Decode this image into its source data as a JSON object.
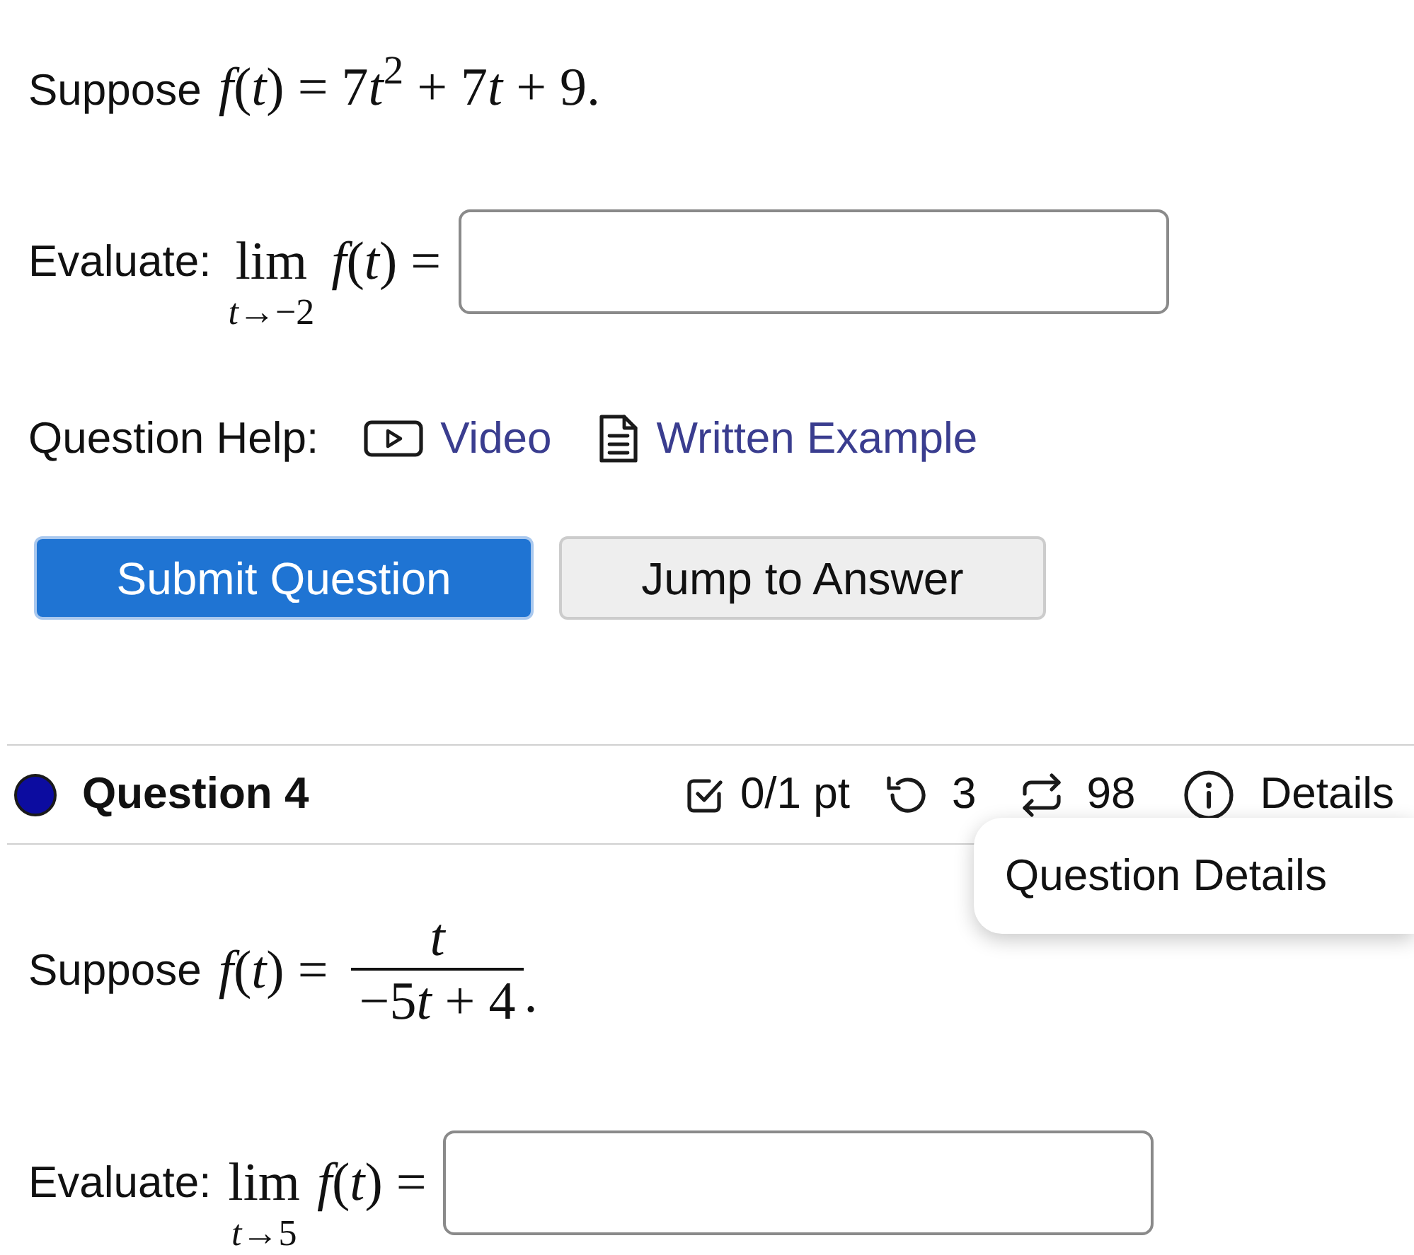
{
  "question_3": {
    "statement": {
      "label": "Suppose",
      "formula": "f(t) = 7t$^{2}$ + 7t + 9."
    },
    "evaluate": {
      "label": "Evaluate:",
      "operator": "lim",
      "subscript": "t→−2",
      "expression": "f(t) ="
    },
    "help": {
      "label": "Question Help:",
      "links": [
        {
          "kind": "video",
          "label": "Video"
        },
        {
          "kind": "document",
          "label": "Written Example"
        }
      ]
    },
    "buttons": [
      {
        "kind": "primary",
        "label": "Submit Question"
      },
      {
        "kind": "secondary",
        "label": "Jump to Answer"
      }
    ]
  },
  "question_4": {
    "header": {
      "color": "#0c0ca0",
      "title": "Question 4",
      "stats": [
        {
          "kind": "score",
          "text": "0/1 pt"
        },
        {
          "kind": "retries",
          "text": "3"
        },
        {
          "kind": "attempts",
          "text": "98"
        },
        {
          "kind": "details",
          "text": "Details"
        }
      ]
    },
    "tooltip": {
      "text": "Question Details"
    },
    "statement": {
      "label": "Suppose",
      "lhs": "f(t) =",
      "numerator": "t",
      "denominator": "−5t + 4",
      "end": "."
    },
    "evaluate": {
      "label": "Evaluate:",
      "operator": "lim",
      "subscript": "t→5",
      "expression": "f(t) ="
    }
  }
}
